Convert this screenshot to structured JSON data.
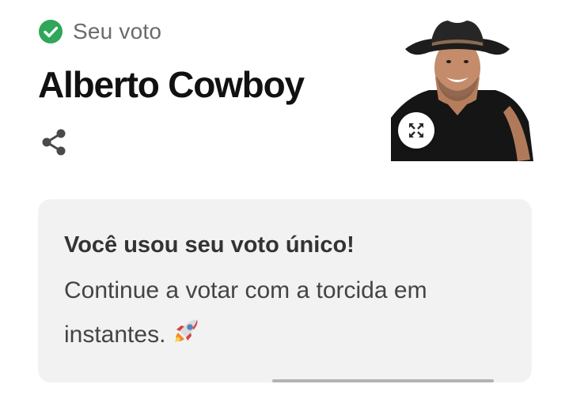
{
  "vote": {
    "status_label": "Seu voto",
    "status_icon": "check-circle-icon",
    "status_color": "#2fa65a"
  },
  "candidate": {
    "name": "Alberto Cowboy",
    "photo": "candidate-photo-cowboy-hat"
  },
  "actions": {
    "share_icon": "share-icon",
    "expand_icon": "expand-icon"
  },
  "message": {
    "title": "Você usou seu voto único!",
    "body": "Continue a votar com a torcida em instantes.",
    "emoji": "rocket-icon"
  },
  "colors": {
    "card_background": "#f2f2f2",
    "title_text": "#111111"
  }
}
